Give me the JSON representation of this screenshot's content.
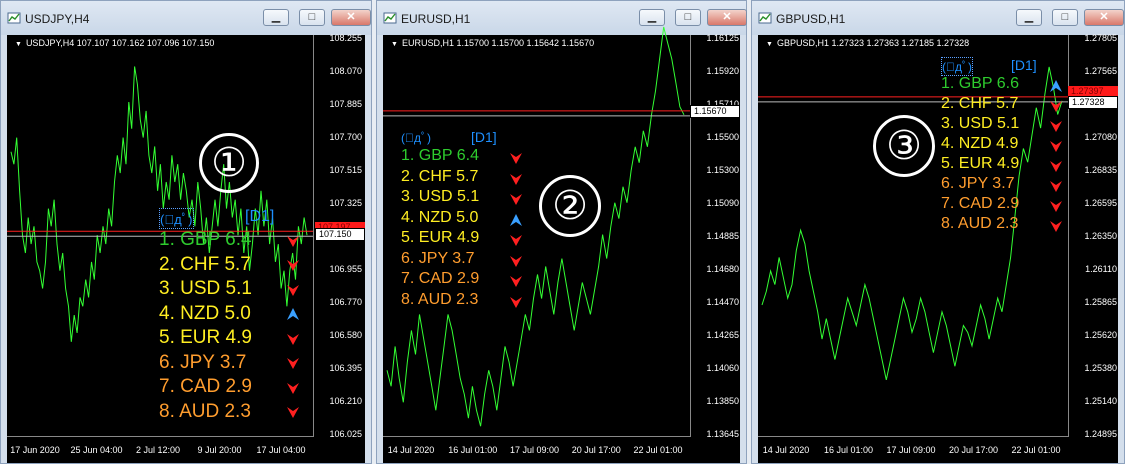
{
  "colors": {
    "up": "#3aa0ff",
    "down": "#ff2020",
    "green": "#2ecc2e",
    "yellow": "#ffee22",
    "orange": "#ff9d2e",
    "line": "#33ff33"
  },
  "windows": [
    {
      "title": "USDJPY,H4",
      "header": "USDJPY,H4  107.107 107.162 107.096 107.150",
      "y_ticks": [
        "108.255",
        "108.070",
        "107.885",
        "107.700",
        "107.515",
        "107.325",
        "107.140",
        "106.955",
        "106.770",
        "106.580",
        "106.395",
        "106.210",
        "106.025"
      ],
      "x_ticks": [
        "17 Jun 2020",
        "25 Jun 04:00",
        "2 Jul 12:00",
        "9 Jul 20:00",
        "17 Jul 04:00"
      ],
      "price_badge_red": "107.197",
      "price_badge_white": "107.150",
      "face": "(ﾟдﾟ)",
      "face_label": "[D1]",
      "circle": "①",
      "ranks": [
        {
          "text": "1. GBP 6.4",
          "color": "green",
          "arrow": "down"
        },
        {
          "text": "2. CHF 5.7",
          "color": "yellow",
          "arrow": "down"
        },
        {
          "text": "3. USD 5.1",
          "color": "yellow",
          "arrow": "down"
        },
        {
          "text": "4. NZD 5.0",
          "color": "yellow",
          "arrow": "up"
        },
        {
          "text": "5. EUR 4.9",
          "color": "yellow",
          "arrow": "down"
        },
        {
          "text": "6. JPY  3.7",
          "color": "orange",
          "arrow": "down"
        },
        {
          "text": "7. CAD 2.9",
          "color": "orange",
          "arrow": "down"
        },
        {
          "text": "8. AUD 2.3",
          "color": "orange",
          "arrow": "down"
        }
      ],
      "series": [
        107.62,
        107.55,
        107.7,
        107.4,
        107.15,
        107.05,
        107.25,
        107.1,
        107.2,
        107.0,
        106.95,
        106.85,
        107.0,
        107.3,
        107.2,
        107.35,
        107.1,
        106.95,
        107.05,
        106.85,
        106.75,
        106.55,
        106.7,
        106.6,
        106.8,
        106.75,
        106.9,
        106.8,
        107.0,
        106.9,
        107.15,
        107.05,
        107.2,
        107.1,
        107.3,
        107.2,
        107.45,
        107.6,
        107.5,
        107.7,
        107.55,
        107.9,
        107.75,
        108.1,
        108.0,
        107.8,
        107.7,
        107.85,
        107.6,
        107.5,
        107.65,
        107.4,
        107.55,
        107.3,
        107.45,
        107.35,
        107.6,
        107.45,
        107.55,
        107.35,
        107.5,
        107.4,
        107.25,
        107.35,
        107.2,
        107.45,
        107.3,
        107.1,
        107.25,
        107.05,
        107.2,
        107.35,
        107.2,
        107.4,
        107.55,
        107.3,
        107.45,
        107.25,
        107.35,
        107.15,
        107.3,
        107.05,
        107.2,
        106.95,
        107.1,
        107.3,
        107.15,
        107.4,
        107.2,
        107.35,
        107.1,
        107.25,
        107.0,
        107.1,
        106.85,
        106.95,
        106.75,
        106.95,
        107.05,
        106.9,
        107.2,
        107.1,
        107.25,
        107.15
      ]
    },
    {
      "title": "EURUSD,H1",
      "header": "EURUSD,H1  1.15700 1.15700 1.15642 1.15670",
      "y_ticks": [
        "1.16125",
        "1.15920",
        "1.15710",
        "1.15500",
        "1.15300",
        "1.15090",
        "1.14885",
        "1.14680",
        "1.14470",
        "1.14265",
        "1.14060",
        "1.13850",
        "1.13645"
      ],
      "x_ticks": [
        "14 Jul 2020",
        "16 Jul 01:00",
        "17 Jul 09:00",
        "20 Jul 17:00",
        "22 Jul 01:00"
      ],
      "price_badge_red": "",
      "price_badge_white": "1.15670",
      "face": "(ﾟдﾟ)",
      "face_label": "[D1]",
      "circle": "②",
      "ranks": [
        {
          "text": "1. GBP 6.4",
          "color": "green",
          "arrow": "down"
        },
        {
          "text": "2. CHF 5.7",
          "color": "yellow",
          "arrow": "down"
        },
        {
          "text": "3. USD 5.1",
          "color": "yellow",
          "arrow": "down"
        },
        {
          "text": "4. NZD 5.0",
          "color": "yellow",
          "arrow": "up"
        },
        {
          "text": "5. EUR 4.9",
          "color": "yellow",
          "arrow": "down"
        },
        {
          "text": "6. JPY  3.7",
          "color": "orange",
          "arrow": "down"
        },
        {
          "text": "7. CAD 2.9",
          "color": "orange",
          "arrow": "down"
        },
        {
          "text": "8. AUD 2.3",
          "color": "orange",
          "arrow": "down"
        }
      ],
      "series": [
        1.1405,
        1.1395,
        1.142,
        1.14,
        1.1385,
        1.141,
        1.143,
        1.1415,
        1.144,
        1.1425,
        1.141,
        1.1395,
        1.138,
        1.14,
        1.142,
        1.144,
        1.143,
        1.1415,
        1.14,
        1.139,
        1.1375,
        1.1395,
        1.138,
        1.137,
        1.139,
        1.1405,
        1.1395,
        1.138,
        1.14,
        1.142,
        1.141,
        1.1395,
        1.141,
        1.1425,
        1.144,
        1.143,
        1.145,
        1.1465,
        1.145,
        1.147,
        1.1455,
        1.144,
        1.146,
        1.1475,
        1.146,
        1.1445,
        1.143,
        1.1445,
        1.146,
        1.145,
        1.144,
        1.1455,
        1.147,
        1.149,
        1.1475,
        1.1495,
        1.151,
        1.15,
        1.152,
        1.151,
        1.153,
        1.1545,
        1.1535,
        1.1555,
        1.1545,
        1.1565,
        1.158,
        1.16,
        1.162,
        1.161,
        1.16,
        1.1585,
        1.157,
        1.1565
      ]
    },
    {
      "title": "GBPUSD,H1",
      "header": "GBPUSD,H1  1.27323 1.27363 1.27185 1.27328",
      "y_ticks": [
        "1.27805",
        "1.27565",
        "1.27330",
        "1.27080",
        "1.26835",
        "1.26595",
        "1.26350",
        "1.26110",
        "1.25865",
        "1.25620",
        "1.25380",
        "1.25140",
        "1.24895"
      ],
      "x_ticks": [
        "14 Jul 2020",
        "16 Jul 01:00",
        "17 Jul 09:00",
        "20 Jul 17:00",
        "22 Jul 01:00"
      ],
      "price_badge_red": "1.27397",
      "price_badge_white": "1.27328",
      "face": "(ﾟдﾟ)",
      "face_label": "[D1]",
      "circle": "③",
      "ranks": [
        {
          "text": "1. GBP 6.6",
          "color": "green",
          "arrow": "up"
        },
        {
          "text": "2. CHF 5.7",
          "color": "yellow",
          "arrow": "down"
        },
        {
          "text": "3. USD 5.1",
          "color": "yellow",
          "arrow": "down"
        },
        {
          "text": "4. NZD 4.9",
          "color": "yellow",
          "arrow": "down"
        },
        {
          "text": "5. EUR 4.9",
          "color": "yellow",
          "arrow": "down"
        },
        {
          "text": "6. JPY  3.7",
          "color": "orange",
          "arrow": "down"
        },
        {
          "text": "7. CAD 2.9",
          "color": "orange",
          "arrow": "down"
        },
        {
          "text": "8. AUD 2.3",
          "color": "orange",
          "arrow": "down"
        }
      ],
      "series": [
        1.2585,
        1.2595,
        1.261,
        1.26,
        1.262,
        1.2605,
        1.259,
        1.26,
        1.2625,
        1.264,
        1.263,
        1.261,
        1.2595,
        1.258,
        1.256,
        1.2575,
        1.256,
        1.2545,
        1.256,
        1.2575,
        1.259,
        1.258,
        1.257,
        1.2585,
        1.26,
        1.259,
        1.2575,
        1.256,
        1.2545,
        1.253,
        1.2545,
        1.256,
        1.2575,
        1.259,
        1.258,
        1.2565,
        1.2575,
        1.259,
        1.258,
        1.2565,
        1.255,
        1.2565,
        1.258,
        1.257,
        1.2555,
        1.254,
        1.2555,
        1.257,
        1.2565,
        1.2555,
        1.257,
        1.2585,
        1.2575,
        1.256,
        1.2575,
        1.259,
        1.258,
        1.26,
        1.262,
        1.265,
        1.268,
        1.27,
        1.269,
        1.271,
        1.273,
        1.2715,
        1.274,
        1.276,
        1.2745,
        1.2725,
        1.2735
      ]
    }
  ]
}
